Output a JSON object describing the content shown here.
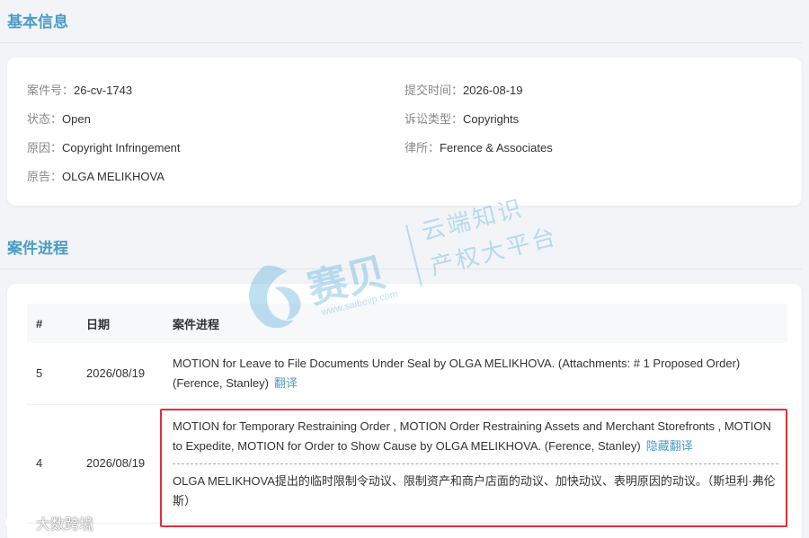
{
  "basic_info": {
    "title": "基本信息",
    "left": [
      {
        "key": "案件号：",
        "value": "26-cv-1743"
      },
      {
        "key": "状态：",
        "value": "Open"
      },
      {
        "key": "原因：",
        "value": "Copyright Infringement"
      },
      {
        "key": "原告：",
        "value": "OLGA MELIKHOVA"
      }
    ],
    "right": [
      {
        "key": "提交时间：",
        "value": "2026-08-19"
      },
      {
        "key": "诉讼类型：",
        "value": "Copyrights"
      },
      {
        "key": "律所：",
        "value": "Ference & Associates"
      }
    ]
  },
  "progress": {
    "title": "案件进程",
    "headers": [
      "#",
      "日期",
      "案件进程"
    ],
    "rows": [
      {
        "num": "5",
        "date": "2026/08/19",
        "text": "MOTION for Leave to File Documents Under Seal by OLGA MELIKHOVA. (Attachments: # 1 Proposed Order) (Ference, Stanley)",
        "link": "翻译"
      },
      {
        "num": "4",
        "date": "2026/08/19",
        "text": "MOTION for Temporary Restraining Order , MOTION Order Restraining Assets and Merchant Storefronts , MOTION to Expedite, MOTION for Order to Show Cause by OLGA MELIKHOVA. (Ference, Stanley)",
        "link": "隐藏翻译",
        "translation": "OLGA MELIKHOVA提出的临时限制令动议、限制资产和商户店面的动议、加快动议、表明原因的动议。（斯坦利·弗伦斯）"
      }
    ]
  },
  "watermark": {
    "brand": "赛贝",
    "url": "www.saibeiip.com",
    "line1": "云端知识",
    "line2": "产权大平台"
  },
  "corner_mark": {
    "text": "大数跨境"
  },
  "colors": {
    "accent": "#4a9cc9",
    "highlight_border": "#e0303a",
    "dashed": "#7fcc6e"
  }
}
